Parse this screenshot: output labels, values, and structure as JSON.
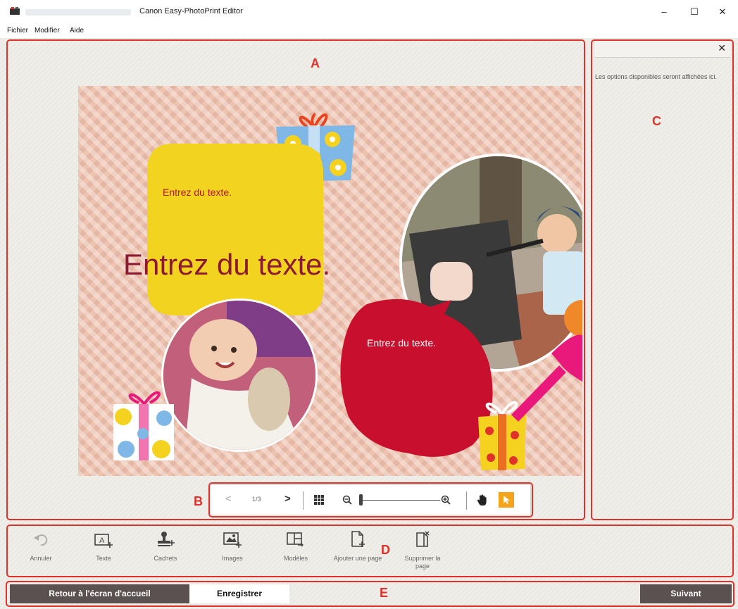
{
  "window": {
    "title": "Canon Easy-PhotoPrint Editor",
    "minimize": "–",
    "maximize": "☐",
    "close": "✕"
  },
  "menu": [
    "Fichier",
    "Modifier",
    "Aide"
  ],
  "regions": {
    "a": "A",
    "b": "B",
    "c": "C",
    "d": "D",
    "e": "E"
  },
  "canvas": {
    "text_small": "Entrez du texte.",
    "text_large": "Entrez du texte.",
    "text_red": "Entrez du texte."
  },
  "navigation": {
    "prev": "<",
    "page": "1/3",
    "next": ">",
    "zoom_level": 0.02
  },
  "side_panel": {
    "close": "✕",
    "message": "Les options disponibles seront affichées ici."
  },
  "toolbar": [
    {
      "label": "Annuler",
      "icon": "undo-icon"
    },
    {
      "label": "Texte",
      "icon": "add-text-icon"
    },
    {
      "label": "Cachets",
      "icon": "stamp-icon"
    },
    {
      "label": "Images",
      "icon": "add-image-icon"
    },
    {
      "label": "Modèles",
      "icon": "layout-icon"
    },
    {
      "label": "Ajouter une page",
      "icon": "add-page-icon"
    },
    {
      "label": "Supprimer la page",
      "icon": "delete-page-icon"
    }
  ],
  "bottom": {
    "home": "Retour à l'écran d'accueil",
    "save": "Enregistrer",
    "next": "Suivant"
  },
  "colors": {
    "region_outline": "#e0322a",
    "dark_button": "#5b5150",
    "select_tool": "#f5a31a"
  }
}
